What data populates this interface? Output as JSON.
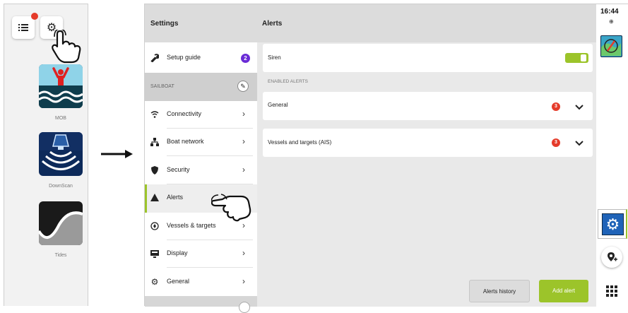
{
  "left_screen": {
    "notification_dot_color": "#e53b2a",
    "apps": [
      {
        "label": "MOB",
        "icon": "man-overboard-icon"
      },
      {
        "label": "DownScan",
        "icon": "downscan-sonar-icon"
      },
      {
        "label": "Tides",
        "icon": "tide-wave-icon"
      }
    ]
  },
  "arrow": "right-arrow-icon",
  "settings": {
    "title": "Settings",
    "setup_guide": {
      "label": "Setup guide",
      "badge": "2"
    },
    "section_header": "SAILBOAT",
    "items": [
      {
        "label": "Connectivity",
        "icon": "wifi-icon"
      },
      {
        "label": "Boat network",
        "icon": "network-icon"
      },
      {
        "label": "Security",
        "icon": "shield-icon"
      },
      {
        "label": "Alerts",
        "icon": "alert-triangle-icon",
        "selected": true
      },
      {
        "label": "Vessels & targets",
        "icon": "vessel-target-icon"
      },
      {
        "label": "Display",
        "icon": "display-icon"
      },
      {
        "label": "General",
        "icon": "gear-icon"
      }
    ]
  },
  "alerts": {
    "title": "Alerts",
    "siren_label": "Siren",
    "siren_on": true,
    "enabled_header": "ENABLED ALERTS",
    "groups": [
      {
        "label": "General",
        "count": "3"
      },
      {
        "label": "Vessels and targets (AIS)",
        "count": "3"
      }
    ],
    "history_button": "Alerts history",
    "add_button": "Add alert"
  },
  "status": {
    "time": "16:44"
  },
  "colors": {
    "accent": "#9cc42a",
    "badge_purple": "#6a2bd6",
    "badge_red": "#e53b2a"
  }
}
